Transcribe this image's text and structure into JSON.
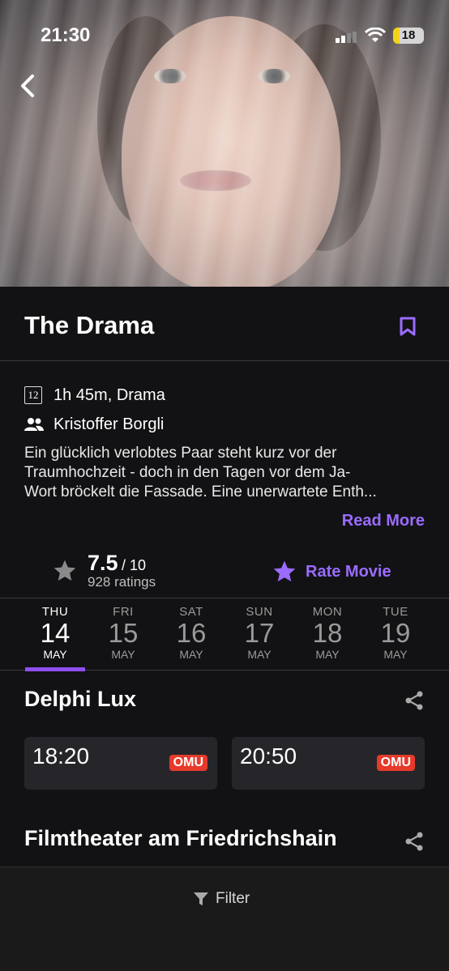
{
  "status_bar": {
    "time": "21:30",
    "battery": "18"
  },
  "movie": {
    "title": "The Drama",
    "age_rating": "12",
    "duration_genre": "1h 45m, Drama",
    "director": "Kristoffer Borgli",
    "description_lines": [
      "Ein glücklich verlobtes Paar steht kurz vor der",
      "Traumhochzeit - doch in den Tagen vor dem Ja-",
      "Wort bröckelt die Fassade. Eine unerwartete Enth..."
    ],
    "read_more": "Read More"
  },
  "rating": {
    "score": "7.5",
    "out_of": "/ 10",
    "count": "928 ratings",
    "rate_label": "Rate Movie"
  },
  "dates": [
    {
      "dow": "THU",
      "day": "14",
      "month": "MAY",
      "active": true
    },
    {
      "dow": "FRI",
      "day": "15",
      "month": "MAY",
      "active": false
    },
    {
      "dow": "SAT",
      "day": "16",
      "month": "MAY",
      "active": false
    },
    {
      "dow": "SUN",
      "day": "17",
      "month": "MAY",
      "active": false
    },
    {
      "dow": "MON",
      "day": "18",
      "month": "MAY",
      "active": false
    },
    {
      "dow": "TUE",
      "day": "19",
      "month": "MAY",
      "active": false
    }
  ],
  "cinemas": [
    {
      "name": "Delphi Lux",
      "showtimes": [
        {
          "time": "18:20",
          "tag": "OMU"
        },
        {
          "time": "20:50",
          "tag": "OMU"
        }
      ]
    },
    {
      "name": "Filmtheater am Friedrichshain",
      "showtimes": []
    }
  ],
  "filter_label": "Filter",
  "colors": {
    "accent": "#9b6cff",
    "tab_indicator": "#8e4ff0",
    "omu_badge": "#e63a2a",
    "background": "#121214"
  },
  "icons": [
    "back-chevron-icon",
    "bookmark-icon",
    "age-rating-icon",
    "people-icon",
    "star-icon",
    "share-icon",
    "filter-icon"
  ]
}
